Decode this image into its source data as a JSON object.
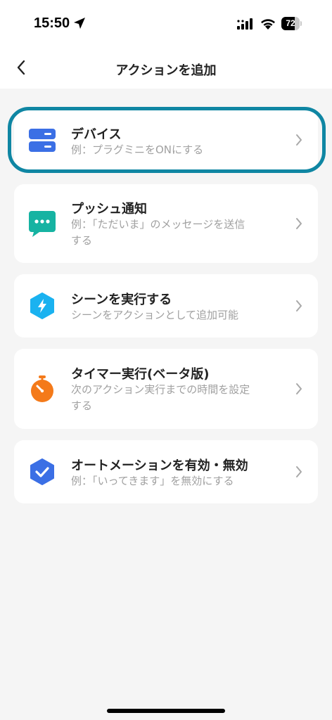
{
  "status_bar": {
    "time": "15:50",
    "battery_level": "72",
    "battery_fraction": 0.72,
    "icons": [
      "location-arrow-icon",
      "cellular-signal-icon",
      "wifi-icon",
      "battery-icon"
    ]
  },
  "nav": {
    "title": "アクションを追加",
    "back_icon": "chevron-left-icon"
  },
  "actions": [
    {
      "title": "デバイス",
      "desc_lines": [
        "例：プラグミニをONにする"
      ],
      "icon": "device-server-icon",
      "icon_color": "#3b6fe5",
      "highlighted": true
    },
    {
      "title": "プッシュ通知",
      "desc_lines": [
        "例：「ただいま」のメッセージを送信",
        "する"
      ],
      "icon": "chat-bubble-icon",
      "icon_color": "#16b3a2"
    },
    {
      "title": "シーンを実行する",
      "desc_lines": [
        "シーンをアクションとして追加可能"
      ],
      "icon": "lightning-hexagon-icon",
      "icon_color": "#1ab2f0"
    },
    {
      "title": "タイマー実行(ベータ版)",
      "desc_lines": [
        "次のアクション実行までの時間を設定",
        "する"
      ],
      "icon": "stopwatch-icon",
      "icon_color": "#f47a1a"
    },
    {
      "title": "オートメーションを有効・無効",
      "desc_lines": [
        "例：「いってきます」を無効にする"
      ],
      "icon": "check-hexagon-icon",
      "icon_color": "#3b6fe5"
    }
  ],
  "colors": {
    "highlight_border": "#0f86a3",
    "background": "#f5f5f5",
    "card": "#ffffff",
    "desc_text": "#a0a0a0"
  }
}
